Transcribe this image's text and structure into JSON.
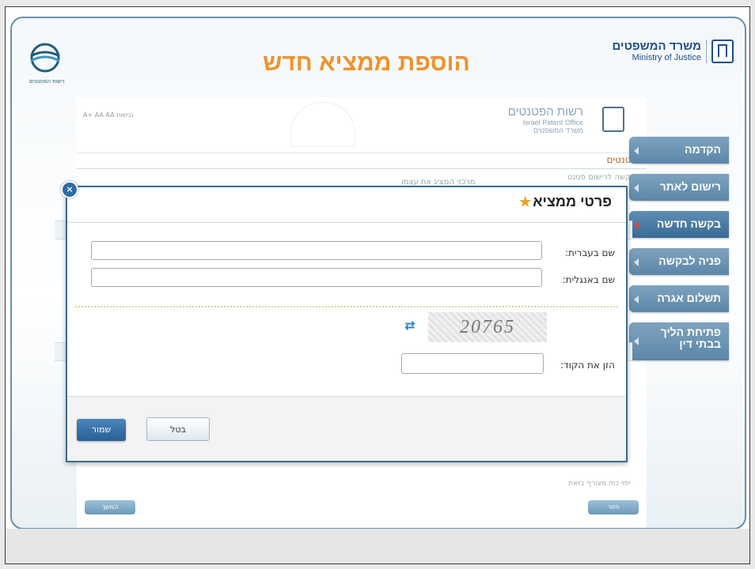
{
  "slide": {
    "title": "הוספת ממציא חדש",
    "ipo_logo_text": "רשות הפטנטים"
  },
  "ministry": {
    "name_he": "משרד המשפטים",
    "name_en": "Ministry of Justice"
  },
  "side_nav": {
    "items": [
      {
        "label": "הקדמה"
      },
      {
        "label": "רישום לאתר"
      },
      {
        "label": "בקשה חדשה"
      },
      {
        "label": "פניה לבקשה"
      },
      {
        "label": "תשלום אגרה"
      },
      {
        "label_line1": "פתיחת הליך",
        "label_line2": "בבתי דין"
      }
    ],
    "active_index": 2
  },
  "app": {
    "toolbar_text": "A+  AA  AA  נגישות",
    "ipo_name_he": "רשות הפטנטים",
    "ipo_name_en": "Israel Patent Office",
    "ipo_ministry": "משרד המשפטים",
    "section_title": "פטנטים",
    "row_right": "בקשה לרישום פטנט",
    "row_middle": "מרכזי המציג את עצמו",
    "footer_check": "יפוי כוח מצורף בזאת",
    "btn_next": "המשך",
    "btn_back": "חזור"
  },
  "dialog": {
    "title": "פרטי ממציא",
    "fields": {
      "hebrew_name_label": "שם בעברית:",
      "hebrew_name_value": "",
      "english_name_label": "שם באנגלית:",
      "english_name_value": "",
      "code_label": "הזן את הקוד:",
      "code_value": ""
    },
    "captcha_text": "20765",
    "buttons": {
      "save": "שמור",
      "cancel": "בטל"
    }
  }
}
